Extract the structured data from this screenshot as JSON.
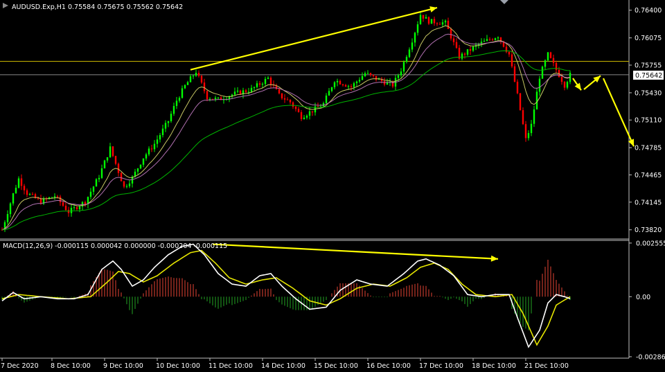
{
  "header": {
    "symbol_info": "AUDUSD.Exp,H1  0.75584 0.75675 0.75562 0.75642",
    "macd_info": "MACD(12,26,9) -0.000115 0.000042 0.000000 -0.000204 -0.000115"
  },
  "colors": {
    "background": "#000000",
    "bull": "#00ff00",
    "bear": "#ff0000",
    "arrow": "#ffff00",
    "ma_fast": "#c8c864",
    "ma_mid": "#b070b0",
    "ma_slow": "#00b400",
    "macd_main": "#ffffff",
    "macd_signal": "#e6e600",
    "hist_pos": "#c0392b",
    "hist_neg": "#1e8a1e",
    "hline_yellow": "#c8b400",
    "hline_gray": "#8a8a8a",
    "axis": "#c0c0c0"
  },
  "chart_data": [
    {
      "type": "candlestick",
      "symbol": "AUDUSD.Exp",
      "timeframe": "H1",
      "last": {
        "open": 0.75584,
        "high": 0.75675,
        "low": 0.75562,
        "close": 0.75642
      },
      "current_price_label": "0.75642",
      "y_ticks": [
        "0.76400",
        "0.76075",
        "0.75755",
        "0.75430",
        "0.75110",
        "0.74785",
        "0.74465",
        "0.74145",
        "0.73820"
      ],
      "y_tick_values": [
        0.764,
        0.76075,
        0.75755,
        0.7543,
        0.7511,
        0.74785,
        0.74465,
        0.74145,
        0.7382
      ],
      "ylim": [
        0.7372,
        0.7652
      ],
      "x_ticks": [
        "7 Dec 2020",
        "8 Dec 10:00",
        "9 Dec 10:00",
        "10 Dec 10:00",
        "11 Dec 10:00",
        "14 Dec 10:00",
        "15 Dec 10:00",
        "16 Dec 10:00",
        "17 Dec 10:00",
        "18 Dec 10:00",
        "21 Dec 10:00"
      ],
      "x_tick_bar_index": [
        0,
        18,
        37,
        56,
        75,
        94,
        113,
        132,
        151,
        170,
        189
      ],
      "total_bars": 206,
      "price_path": [
        [
          0,
          0.7382
        ],
        [
          4,
          0.7424
        ],
        [
          6,
          0.7442
        ],
        [
          9,
          0.7425
        ],
        [
          14,
          0.7415
        ],
        [
          19,
          0.7422
        ],
        [
          24,
          0.7403
        ],
        [
          30,
          0.7415
        ],
        [
          35,
          0.7445
        ],
        [
          39,
          0.7478
        ],
        [
          44,
          0.7432
        ],
        [
          47,
          0.7443
        ],
        [
          51,
          0.7467
        ],
        [
          55,
          0.7483
        ],
        [
          60,
          0.751
        ],
        [
          63,
          0.7534
        ],
        [
          66,
          0.7551
        ],
        [
          70,
          0.7568
        ],
        [
          74,
          0.7538
        ],
        [
          78,
          0.7535
        ],
        [
          84,
          0.7542
        ],
        [
          90,
          0.7547
        ],
        [
          96,
          0.756
        ],
        [
          100,
          0.754
        ],
        [
          104,
          0.7532
        ],
        [
          108,
          0.7515
        ],
        [
          112,
          0.7522
        ],
        [
          116,
          0.753
        ],
        [
          120,
          0.7558
        ],
        [
          126,
          0.755
        ],
        [
          131,
          0.7566
        ],
        [
          136,
          0.7558
        ],
        [
          141,
          0.7552
        ],
        [
          144,
          0.757
        ],
        [
          148,
          0.7605
        ],
        [
          151,
          0.7635
        ],
        [
          154,
          0.7627
        ],
        [
          160,
          0.7625
        ],
        [
          165,
          0.7585
        ],
        [
          172,
          0.76
        ],
        [
          179,
          0.761
        ],
        [
          183,
          0.7588
        ],
        [
          186,
          0.754
        ],
        [
          189,
          0.7488
        ],
        [
          191,
          0.7505
        ],
        [
          194,
          0.7562
        ],
        [
          197,
          0.7588
        ],
        [
          200,
          0.757
        ],
        [
          203,
          0.7552
        ],
        [
          205,
          0.7564
        ]
      ],
      "horizontal_lines": [
        {
          "price": 0.758,
          "color": "#c8b400"
        },
        {
          "price": 0.75642,
          "color": "#8a8a8a"
        }
      ],
      "arrows": [
        {
          "from": [
            68,
            0.757
          ],
          "to": [
            157,
            0.7643
          ]
        },
        {
          "from": [
            206,
            0.756
          ],
          "to": [
            209,
            0.7546
          ]
        },
        {
          "from": [
            210,
            0.7547
          ],
          "to": [
            216,
            0.7563
          ]
        },
        {
          "from": [
            217,
            0.756
          ],
          "to": [
            228,
            0.748
          ]
        }
      ]
    },
    {
      "type": "macd",
      "title": "MACD(12,26,9) -0.000115 0.000042 0.000000 -0.000204 -0.000115",
      "y_ticks": [
        "0.002555",
        "0.00",
        "-0.002862"
      ],
      "y_tick_values": [
        0.002555,
        0.0,
        -0.002862
      ],
      "ylim": [
        -0.00293,
        0.00265
      ],
      "main_path": [
        [
          0,
          -0.0002
        ],
        [
          4,
          0.0002
        ],
        [
          8,
          -0.0001
        ],
        [
          14,
          0.0
        ],
        [
          20,
          -0.0001
        ],
        [
          26,
          -0.0001
        ],
        [
          31,
          0.0001
        ],
        [
          36,
          0.0013
        ],
        [
          40,
          0.0017
        ],
        [
          43,
          0.0013
        ],
        [
          47,
          0.0005
        ],
        [
          51,
          0.0008
        ],
        [
          55,
          0.0014
        ],
        [
          60,
          0.002
        ],
        [
          65,
          0.0024
        ],
        [
          69,
          0.0025
        ],
        [
          73,
          0.002
        ],
        [
          78,
          0.0011
        ],
        [
          83,
          0.0006
        ],
        [
          88,
          0.0005
        ],
        [
          93,
          0.001
        ],
        [
          97,
          0.0011
        ],
        [
          101,
          0.0005
        ],
        [
          106,
          -0.0001
        ],
        [
          111,
          -0.0006
        ],
        [
          117,
          -0.0005
        ],
        [
          122,
          0.0003
        ],
        [
          128,
          0.0008
        ],
        [
          133,
          0.0006
        ],
        [
          139,
          0.0005
        ],
        [
          145,
          0.0011
        ],
        [
          150,
          0.0017
        ],
        [
          153,
          0.0018
        ],
        [
          158,
          0.0015
        ],
        [
          163,
          0.001
        ],
        [
          168,
          0.0001
        ],
        [
          173,
          0.0
        ],
        [
          178,
          0.0001
        ],
        [
          183,
          0.0001
        ],
        [
          186,
          -0.001
        ],
        [
          190,
          -0.0024
        ],
        [
          194,
          -0.0016
        ],
        [
          197,
          -0.0003
        ],
        [
          200,
          0.0001
        ],
        [
          203,
          0.0
        ],
        [
          205,
          -0.0001
        ]
      ],
      "signal_path": [
        [
          0,
          -0.0001
        ],
        [
          6,
          0.0001
        ],
        [
          14,
          0.0
        ],
        [
          24,
          -0.0001
        ],
        [
          32,
          0.0
        ],
        [
          38,
          0.0007
        ],
        [
          42,
          0.0012
        ],
        [
          46,
          0.0011
        ],
        [
          51,
          0.0007
        ],
        [
          56,
          0.001
        ],
        [
          62,
          0.0016
        ],
        [
          68,
          0.0021
        ],
        [
          72,
          0.0022
        ],
        [
          77,
          0.0016
        ],
        [
          82,
          0.0009
        ],
        [
          88,
          0.0006
        ],
        [
          94,
          0.0008
        ],
        [
          99,
          0.0009
        ],
        [
          105,
          0.0004
        ],
        [
          111,
          -0.0002
        ],
        [
          117,
          -0.0004
        ],
        [
          122,
          -0.0001
        ],
        [
          128,
          0.0004
        ],
        [
          134,
          0.0006
        ],
        [
          140,
          0.0005
        ],
        [
          146,
          0.0009
        ],
        [
          151,
          0.0014
        ],
        [
          156,
          0.0016
        ],
        [
          161,
          0.0013
        ],
        [
          166,
          0.0006
        ],
        [
          171,
          0.0001
        ],
        [
          178,
          0.0
        ],
        [
          184,
          0.0001
        ],
        [
          188,
          -0.0008
        ],
        [
          193,
          -0.0023
        ],
        [
          197,
          -0.0014
        ],
        [
          200,
          -0.0004
        ],
        [
          205,
          0.0
        ]
      ],
      "arrow": {
        "from": [
          76,
          0.0025
        ],
        "to": [
          179,
          0.0018
        ]
      }
    }
  ]
}
